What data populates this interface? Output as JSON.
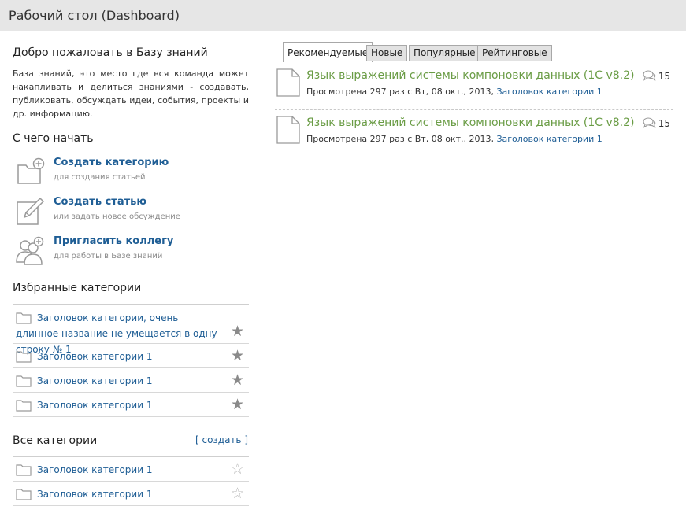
{
  "window": {
    "title": "Рабочий стол (Dashboard)"
  },
  "welcome": {
    "heading": "Добро пожаловать в Базу знаний",
    "text": "База знаний, это место где вся команда может накапливать и делиться знаниями - создавать, публиковать, обсуждать идеи, события, проекты и др. информацию."
  },
  "start": {
    "heading": "С чего начать",
    "actions": [
      {
        "label": "Создать категорию",
        "sub": "для создания статьей",
        "icon": "folder-add-icon"
      },
      {
        "label": "Создать статью",
        "sub": "или задать новое обсуждение",
        "icon": "edit-icon"
      },
      {
        "label": "Пригласить коллегу",
        "sub": "для работы в Базе знаний",
        "icon": "invite-users-icon"
      }
    ]
  },
  "favorites": {
    "heading": "Избранные категории",
    "items": [
      {
        "title": "Заголовок категории, очень длинное название не умещается в одну строку № 1",
        "starred": true
      },
      {
        "title": "Заголовок категории 1",
        "starred": true
      },
      {
        "title": "Заголовок категории 1",
        "starred": true
      },
      {
        "title": "Заголовок категории 1",
        "starred": true
      }
    ]
  },
  "all_categories": {
    "heading": "Все категории",
    "create_label": "[ создать ]",
    "items": [
      {
        "title": "Заголовок категории 1",
        "starred": false
      },
      {
        "title": "Заголовок категории 1",
        "starred": false
      }
    ]
  },
  "tabs": [
    {
      "label": "Рекомендуемые",
      "active": true
    },
    {
      "label": "Новые",
      "active": false
    },
    {
      "label": "Популярные",
      "active": false
    },
    {
      "label": "Рейтинговые",
      "active": false
    }
  ],
  "articles": [
    {
      "title": "Язык выражений системы компоновки данных (1С v8.2)",
      "meta_prefix": "Просмотрена 297 раз с Вт, 08 окт., 2013,",
      "category": "Заголовок категории 1",
      "comments": "15"
    },
    {
      "title": "Язык выражений системы компоновки данных (1С v8.2)",
      "meta_prefix": "Просмотрена 297 раз с Вт, 08 окт., 2013,",
      "category": "Заголовок категории 1",
      "comments": "15"
    }
  ],
  "icons": {
    "favorite_star": "star-filled-icon",
    "all_star": "star-empty-icon",
    "category": "folder-icon",
    "article": "document-icon",
    "comments": "comment-icon"
  },
  "colors": {
    "link": "#1f5e95",
    "article_title": "#6a9c45",
    "titlebar": "#e6e6e6"
  }
}
